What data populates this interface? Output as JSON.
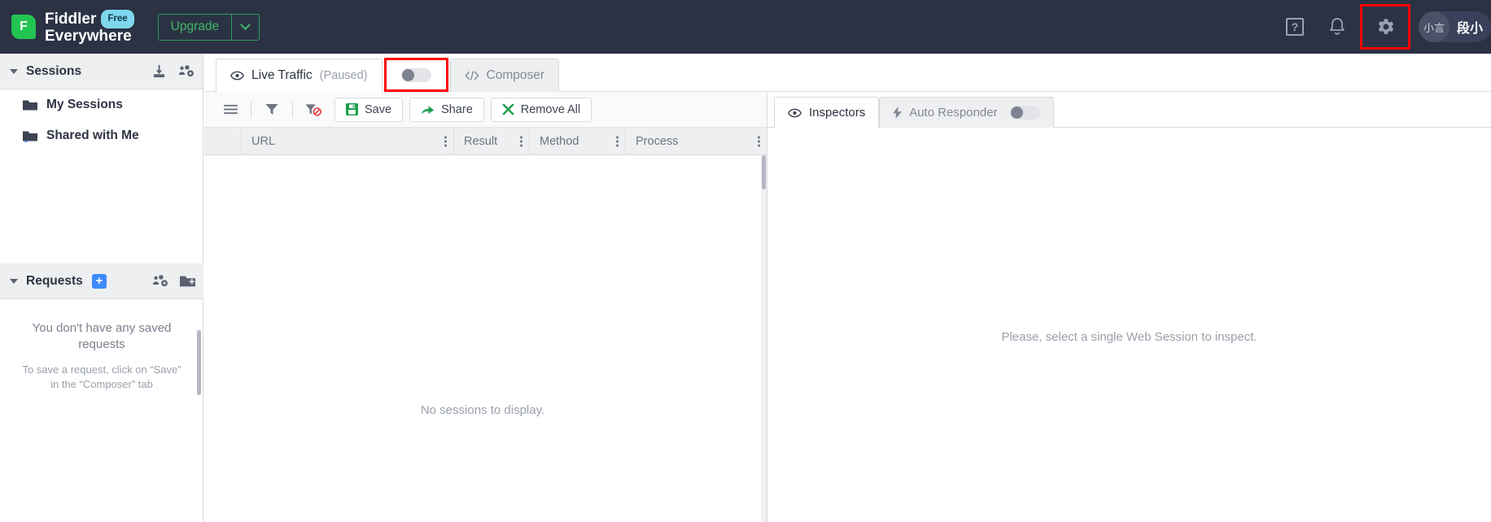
{
  "app": {
    "brand_line1": "Fiddler",
    "brand_line2": "Everywhere",
    "logo_letter": "F",
    "plan_badge": "Free",
    "upgrade_label": "Upgrade",
    "accent_green": "#23c552",
    "header_bg": "#2b3244",
    "highlight_color": "#ff0000"
  },
  "header": {
    "help_label": "?",
    "icons": [
      "help-icon",
      "notifications-bell-icon",
      "settings-gear-icon"
    ],
    "user": {
      "avatar_text": "小言",
      "name": "段小"
    }
  },
  "sidebar": {
    "sessions": {
      "title": "Sessions",
      "items": [
        {
          "label": "My Sessions",
          "icon": "folder-icon"
        },
        {
          "label": "Shared with Me",
          "icon": "shared-folder-icon"
        }
      ]
    },
    "requests": {
      "title": "Requests",
      "add_label": "+",
      "empty_title": "You don't have any saved requests",
      "empty_sub": "To save a request, click on “Save” in the “Composer” tab"
    }
  },
  "tabs": {
    "live_traffic": {
      "label": "Live Traffic",
      "status": "(Paused)",
      "icon": "eye-icon"
    },
    "capture_toggle": {
      "state": "off",
      "name": "capture-traffic-toggle"
    },
    "composer": {
      "label": "Composer",
      "icon": "code-icon"
    }
  },
  "toolbar": {
    "menu_icon": "hamburger-menu-icon",
    "filter_icon": "filter-icon",
    "clear_filter_icon": "clear-filter-icon",
    "save_label": "Save",
    "share_label": "Share",
    "remove_all_label": "Remove All"
  },
  "table": {
    "columns": [
      "URL",
      "Result",
      "Method",
      "Process"
    ],
    "rows": [],
    "empty_message": "No sessions to display."
  },
  "inspector": {
    "tabs": [
      {
        "label": "Inspectors",
        "icon": "eye-icon",
        "active": true
      },
      {
        "label": "Auto Responder",
        "icon": "lightning-icon",
        "active": false
      }
    ],
    "auto_responder_toggle": "off",
    "empty_message": "Please, select a single Web Session to inspect."
  }
}
